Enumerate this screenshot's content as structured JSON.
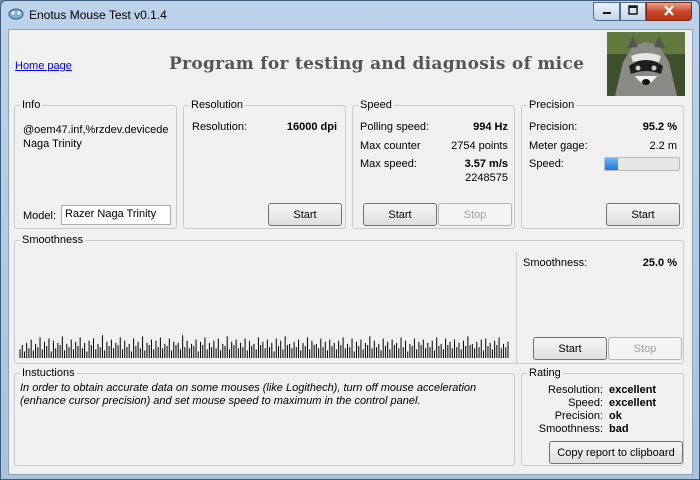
{
  "window": {
    "title": "Enotus Mouse Test v0.1.4"
  },
  "header": {
    "home_link": "Home page",
    "banner": "Program for testing and diagnosis of mice"
  },
  "info": {
    "title": "Info",
    "line1": "@oem47.inf,%rzdev.devicede",
    "line2": "Naga Trinity",
    "model_label": "Model:",
    "model_value": "Razer Naga Trinity"
  },
  "resolution": {
    "title": "Resolution",
    "label": "Resolution:",
    "value": "16000 dpi",
    "start": "Start"
  },
  "speed": {
    "title": "Speed",
    "polling_label": "Polling speed:",
    "polling_value": "994 Hz",
    "counter_label": "Max counter",
    "counter_value": "2754 points",
    "max_label": "Max  speed:",
    "max_value": "3.57 m/s",
    "max_sub": "2248575",
    "start": "Start",
    "stop": "Stop"
  },
  "precision": {
    "title": "Precision",
    "precision_label": "Precision:",
    "precision_value": "95.2 %",
    "gage_label": "Meter gage:",
    "gage_value": "2.2 m",
    "speed_label": "Speed:",
    "speed_level": 0.17,
    "start": "Start"
  },
  "smoothness": {
    "title": "Smoothness",
    "label": "Smoothness:",
    "value": "25.0 %",
    "start": "Start",
    "stop": "Stop",
    "bars": [
      8,
      12,
      6,
      14,
      9,
      17,
      7,
      13,
      10,
      19,
      8,
      15,
      11,
      18,
      6,
      16,
      9,
      14,
      12,
      20,
      7,
      13,
      10,
      17,
      8,
      15,
      11,
      19,
      9,
      14,
      6,
      16,
      12,
      18,
      8,
      13,
      10,
      21,
      7,
      15,
      11,
      17,
      9,
      14,
      12,
      19,
      8,
      16,
      10,
      13,
      6,
      18,
      11,
      15,
      9,
      20,
      7,
      14,
      12,
      17,
      8,
      16,
      10,
      19,
      9,
      13,
      11,
      18,
      7,
      15,
      12,
      14,
      8,
      21,
      10,
      16,
      9,
      13,
      11,
      17,
      6,
      15,
      12,
      19,
      8,
      14,
      10,
      16,
      9,
      18,
      7,
      13,
      11,
      20,
      8,
      15,
      12,
      17,
      9,
      14,
      10,
      18,
      7,
      16,
      11,
      13,
      8,
      19,
      12,
      15,
      9,
      17,
      10,
      14,
      6,
      18,
      11,
      16,
      8,
      20,
      12,
      13,
      9,
      15,
      10,
      17,
      7,
      14,
      11,
      19,
      8,
      16,
      12,
      13,
      9,
      18,
      10,
      15,
      7,
      17,
      11,
      14,
      8,
      16,
      12,
      19,
      9,
      13,
      10,
      18,
      6,
      15,
      11,
      17,
      8,
      14,
      12,
      20,
      9,
      16,
      10,
      13,
      7,
      18,
      11,
      15,
      8,
      17,
      12,
      14,
      9,
      19,
      10,
      16,
      6,
      13,
      11,
      18,
      8,
      15,
      12,
      17,
      9,
      14,
      10,
      16,
      7,
      19,
      11,
      13,
      8,
      18,
      12,
      15,
      9,
      17,
      10,
      14,
      8,
      16,
      11,
      20,
      12,
      13,
      9,
      15,
      10,
      17,
      7,
      18,
      11,
      14,
      8,
      16,
      12,
      19,
      9,
      13,
      10,
      15
    ],
    "bar_max": 24
  },
  "instructions": {
    "title": "Instuctions",
    "text": "In order to obtain accurate data on some mouses (like Logithech), turn off mouse acceleration (enhance cursor precision) and set mouse speed to maximum in the control panel."
  },
  "rating": {
    "title": "Rating",
    "items": [
      {
        "label": "Resolution:",
        "value": "excellent"
      },
      {
        "label": "Speed:",
        "value": "excellent"
      },
      {
        "label": "Precision:",
        "value": "ok"
      },
      {
        "label": "Smoothness:",
        "value": "bad"
      }
    ],
    "copy_button": "Copy report to clipboard"
  },
  "colors": {
    "titlebar": "#bcd3ea",
    "close_button": "#c9472a",
    "client_bg": "#f0f0f0",
    "link": "#0000ee",
    "progress_fill": "#1f78d6",
    "smooth_bars": "#000000"
  }
}
